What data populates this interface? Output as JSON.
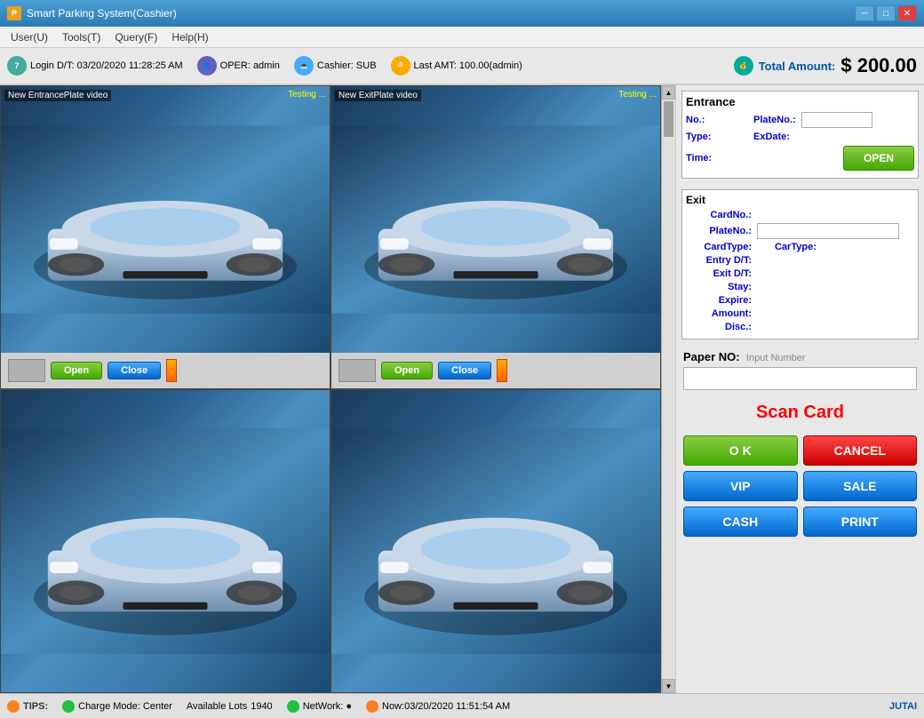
{
  "titlebar": {
    "icon": "P",
    "title": "Smart Parking System(Cashier)",
    "min": "─",
    "max": "□",
    "close": "✕"
  },
  "menubar": {
    "items": [
      {
        "label": "User(U)"
      },
      {
        "label": "Tools(T)"
      },
      {
        "label": "Query(F)"
      },
      {
        "label": "Help(H)"
      }
    ]
  },
  "infobar": {
    "login": "Login D/T: 03/20/2020 11:28:25 AM",
    "oper": "OPER: admin",
    "cashier": "Cashier: SUB",
    "lastamt": "Last AMT: 100.00(admin)",
    "total_label": "Total Amount:",
    "total_value": "$ 200.00"
  },
  "cameras": [
    {
      "label": "New EntrancePlate video",
      "testing": "Testing ..."
    },
    {
      "label": "New ExitPlate video",
      "testing": "Testing ..."
    },
    {
      "label": "",
      "testing": ""
    },
    {
      "label": "",
      "testing": ""
    }
  ],
  "controls": [
    {
      "open": "Open",
      "close": "Close"
    },
    {
      "open": "Open",
      "close": "Close"
    }
  ],
  "entrance": {
    "title": "Entrance",
    "no_label": "No.:",
    "plateno_label": "PlateNo.:",
    "type_label": "Type:",
    "exdate_label": "ExDate:",
    "time_label": "Time:",
    "open_btn": "OPEN"
  },
  "exit": {
    "title": "Exit",
    "cardno_label": "CardNo.:",
    "plateno_label": "PlateNo.:",
    "cardtype_label": "CardType:",
    "cartype_label": "CarType:",
    "entry_label": "Entry D/T:",
    "exit_label": "Exit D/T:",
    "stay_label": "Stay:",
    "expire_label": "Expire:",
    "amount_label": "Amount:",
    "disc_label": "Disc.:"
  },
  "paper": {
    "label": "Paper NO:",
    "hint": "Input Number"
  },
  "scan_card": {
    "text": "Scan Card"
  },
  "buttons": {
    "ok": "O K",
    "cancel": "CANCEL",
    "vip": "VIP",
    "sale": "SALE",
    "cash": "CASH",
    "print": "PRINT"
  },
  "statusbar": {
    "tips": "TIPS:",
    "charge": "Charge Mode: Center",
    "available": "Available Lots",
    "lots": "1940",
    "network": "NetWork: ●",
    "now": "Now:03/20/2020 11:51:54 AM",
    "logo": "JUTAI"
  }
}
